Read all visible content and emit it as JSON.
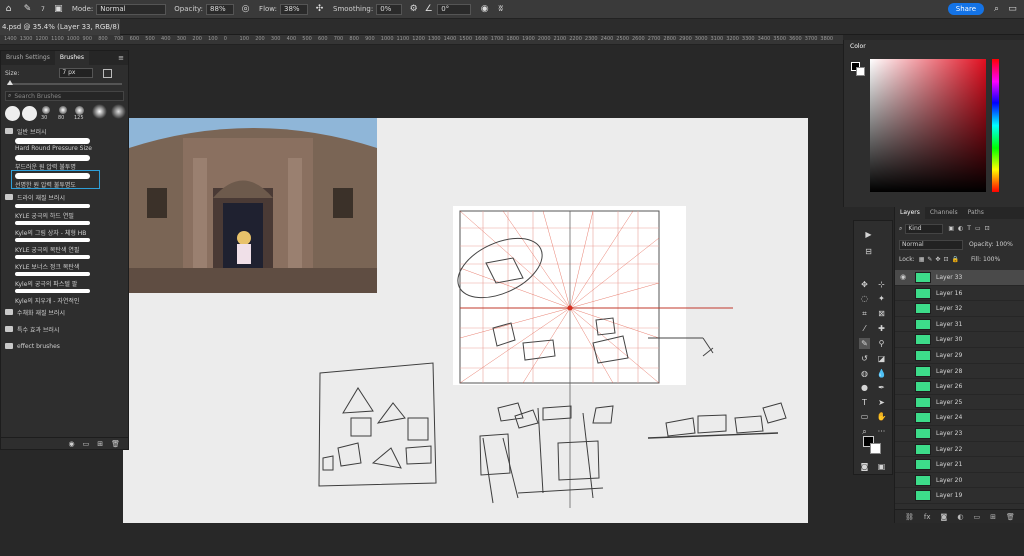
{
  "options_bar": {
    "mode_label": "Mode:",
    "mode_value": "Normal",
    "opacity_label": "Opacity:",
    "opacity_value": "88%",
    "flow_label": "Flow:",
    "flow_value": "38%",
    "smoothing_label": "Smoothing:",
    "smoothing_value": "0%",
    "angle_value": "0°",
    "share_label": "Share",
    "brush_size_display": "7"
  },
  "document_tab": {
    "title": "4.psd @ 35.4% (Layer 33, RGB/8) *"
  },
  "ruler": [
    "1400",
    "1300",
    "1200",
    "1100",
    "1000",
    "900",
    "800",
    "700",
    "600",
    "500",
    "400",
    "300",
    "200",
    "100",
    "0",
    "100",
    "200",
    "300",
    "400",
    "500",
    "600",
    "700",
    "800",
    "900",
    "1000",
    "1100",
    "1200",
    "1300",
    "1400",
    "1500",
    "1600",
    "1700",
    "1800",
    "1900",
    "2000",
    "2100",
    "2200",
    "2300",
    "2400",
    "2500",
    "2600",
    "2700",
    "2800",
    "2900",
    "3000",
    "3100",
    "3200",
    "3300",
    "3400",
    "3500",
    "3600",
    "3700",
    "3800"
  ],
  "brush_panel": {
    "tabs": [
      "Brush Settings",
      "Brushes"
    ],
    "size_label": "Size:",
    "size_value": "7 px",
    "search_placeholder": "Search Brushes",
    "preset_sizes": [
      "30",
      "80",
      "125"
    ],
    "groups": [
      {
        "name": "일반 브러시",
        "items": [
          "Hard Round Pressure Size",
          "부드러운 원 압력 불투명",
          "선명한 원 압력 불투명도"
        ]
      },
      {
        "name": "드라이 재질 브러시",
        "items": [
          "KYLE 궁극의 하드 연필",
          "Kyle의 그림 상자 - 체형 HB",
          "KYLE 궁극의 목탄색 연필",
          "KYLE 보너스 정크 목탄색",
          "Kyle의 궁극의 파스텔 팔",
          "Kyle의 지우개 - 자연적인"
        ]
      },
      {
        "name": "수채화 재질 브러시"
      },
      {
        "name": "특수 효과 브러시"
      },
      {
        "name": "effect brushes"
      }
    ]
  },
  "color_panel": {
    "title": "Color"
  },
  "layers_panel": {
    "tabs": [
      "Layers",
      "Channels",
      "Paths"
    ],
    "kind_label": "Kind",
    "blend_mode": "Normal",
    "opacity_label": "Opacity:",
    "opacity_value": "100%",
    "lock_label": "Lock:",
    "fill_label": "Fill:",
    "fill_value": "100%",
    "layers": [
      "Layer 33",
      "Layer 16",
      "Layer 32",
      "Layer 31",
      "Layer 30",
      "Layer 29",
      "Layer 28",
      "Layer 26",
      "Layer 25",
      "Layer 24",
      "Layer 23",
      "Layer 22",
      "Layer 21",
      "Layer 20",
      "Layer 19"
    ],
    "selected_index": 0
  }
}
